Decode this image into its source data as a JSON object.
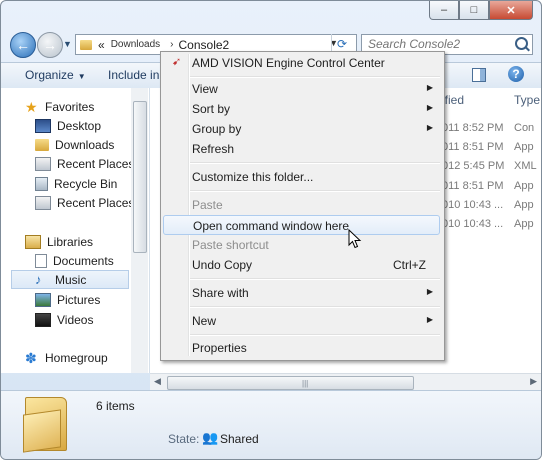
{
  "window": {
    "minimize_label": "–",
    "maximize_label": "□",
    "close_label": "✕"
  },
  "address": {
    "overflow": "«",
    "crumbs": [
      "Downloads",
      "Console2"
    ],
    "separator": "›"
  },
  "search": {
    "placeholder": "Search Console2"
  },
  "toolbar": {
    "organize": "Organize",
    "include_in_library": "Include in"
  },
  "navpane": {
    "items": [
      {
        "label": "Favorites",
        "icon": "star-icon"
      },
      {
        "label": "Desktop",
        "icon": "desktop-icon"
      },
      {
        "label": "Downloads",
        "icon": "folder-icon"
      },
      {
        "label": "Recent Places",
        "icon": "recent-places-icon"
      },
      {
        "label": "Recycle Bin",
        "icon": "recycle-bin-icon"
      },
      {
        "label": "Recent Places",
        "icon": "recent-places-icon"
      },
      {
        "label": "Libraries",
        "icon": "libraries-icon"
      },
      {
        "label": "Documents",
        "icon": "documents-icon"
      },
      {
        "label": "Music",
        "icon": "music-icon"
      },
      {
        "label": "Pictures",
        "icon": "pictures-icon"
      },
      {
        "label": "Videos",
        "icon": "videos-icon"
      },
      {
        "label": "Homegroup",
        "icon": "homegroup-icon"
      }
    ],
    "selected": "Music"
  },
  "content": {
    "columns": [
      "ified",
      "Type"
    ],
    "rows": [
      {
        "date": "011 8:52 PM",
        "type": "Con"
      },
      {
        "date": "011 8:51 PM",
        "type": "App"
      },
      {
        "date": "012 5:45 PM",
        "type": "XML"
      },
      {
        "date": "011 8:51 PM",
        "type": "App"
      },
      {
        "date": "010 10:43 ...",
        "type": "App"
      },
      {
        "date": "010 10:43 ...",
        "type": "App"
      }
    ]
  },
  "context_menu": {
    "items": [
      {
        "label": "AMD VISION Engine Control Center",
        "has_submenu": false,
        "disabled": false,
        "icon": "amd-icon"
      },
      {
        "label": "View",
        "has_submenu": true,
        "disabled": false
      },
      {
        "label": "Sort by",
        "has_submenu": true,
        "disabled": false
      },
      {
        "label": "Group by",
        "has_submenu": true,
        "disabled": false
      },
      {
        "label": "Refresh",
        "has_submenu": false,
        "disabled": false
      },
      {
        "label": "Customize this folder...",
        "has_submenu": false,
        "disabled": false
      },
      {
        "label": "Paste",
        "has_submenu": false,
        "disabled": true
      },
      {
        "label": "Open command window here",
        "has_submenu": false,
        "disabled": false,
        "highlighted": true
      },
      {
        "label": "Paste shortcut",
        "has_submenu": false,
        "disabled": true
      },
      {
        "label": "Undo Copy",
        "shortcut": "Ctrl+Z",
        "has_submenu": false,
        "disabled": false
      },
      {
        "label": "Share with",
        "has_submenu": true,
        "disabled": false
      },
      {
        "label": "New",
        "has_submenu": true,
        "disabled": false
      },
      {
        "label": "Properties",
        "has_submenu": false,
        "disabled": false
      }
    ],
    "submenu_arrow": "▶"
  },
  "details": {
    "items_count": "6 items",
    "state_label": "State:",
    "state_value": "Shared"
  },
  "colors": {
    "highlight_border": "#aeccef",
    "menu_bg": "#f0f0f0",
    "toolbar_text": "#1e3a5f"
  }
}
